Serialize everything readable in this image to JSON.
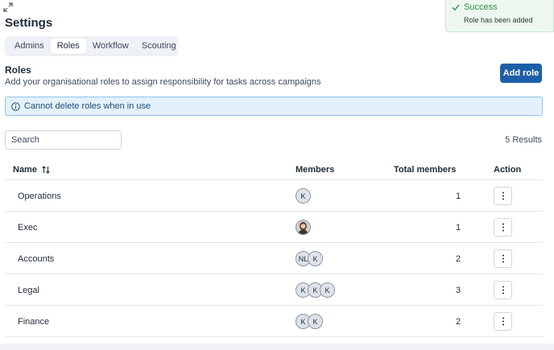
{
  "page": {
    "title": "Settings"
  },
  "tabs": [
    {
      "label": "Admins",
      "active": false
    },
    {
      "label": "Roles",
      "active": true
    },
    {
      "label": "Workflow",
      "active": false
    },
    {
      "label": "Scouting",
      "active": false
    }
  ],
  "section": {
    "title": "Roles",
    "description": "Add your organisational roles to assign responsibility for tasks across campaigns",
    "add_button": "Add role"
  },
  "info_banner": {
    "text": "Cannot delete roles when in use",
    "icon": "info-icon"
  },
  "search": {
    "placeholder": "Search",
    "value": ""
  },
  "results_text": "5 Results",
  "table": {
    "headers": {
      "name": "Name",
      "members": "Members",
      "total": "Total members",
      "action": "Action"
    },
    "rows": [
      {
        "name": "Operations",
        "members": [
          "K"
        ],
        "total": "1"
      },
      {
        "name": "Exec",
        "members": [
          "photo"
        ],
        "total": "1"
      },
      {
        "name": "Accounts",
        "members": [
          "NL",
          "K"
        ],
        "total": "2"
      },
      {
        "name": "Legal",
        "members": [
          "K",
          "K",
          "K"
        ],
        "total": "3"
      },
      {
        "name": "Finance",
        "members": [
          "K",
          "K"
        ],
        "total": "2"
      }
    ]
  },
  "toast": {
    "title": "Success",
    "message": "Role has been added"
  },
  "colors": {
    "primary": "#1d5ea8",
    "success": "#2e8a45",
    "info_bg": "#e4f1fb",
    "info_border": "#8fc3ea"
  }
}
